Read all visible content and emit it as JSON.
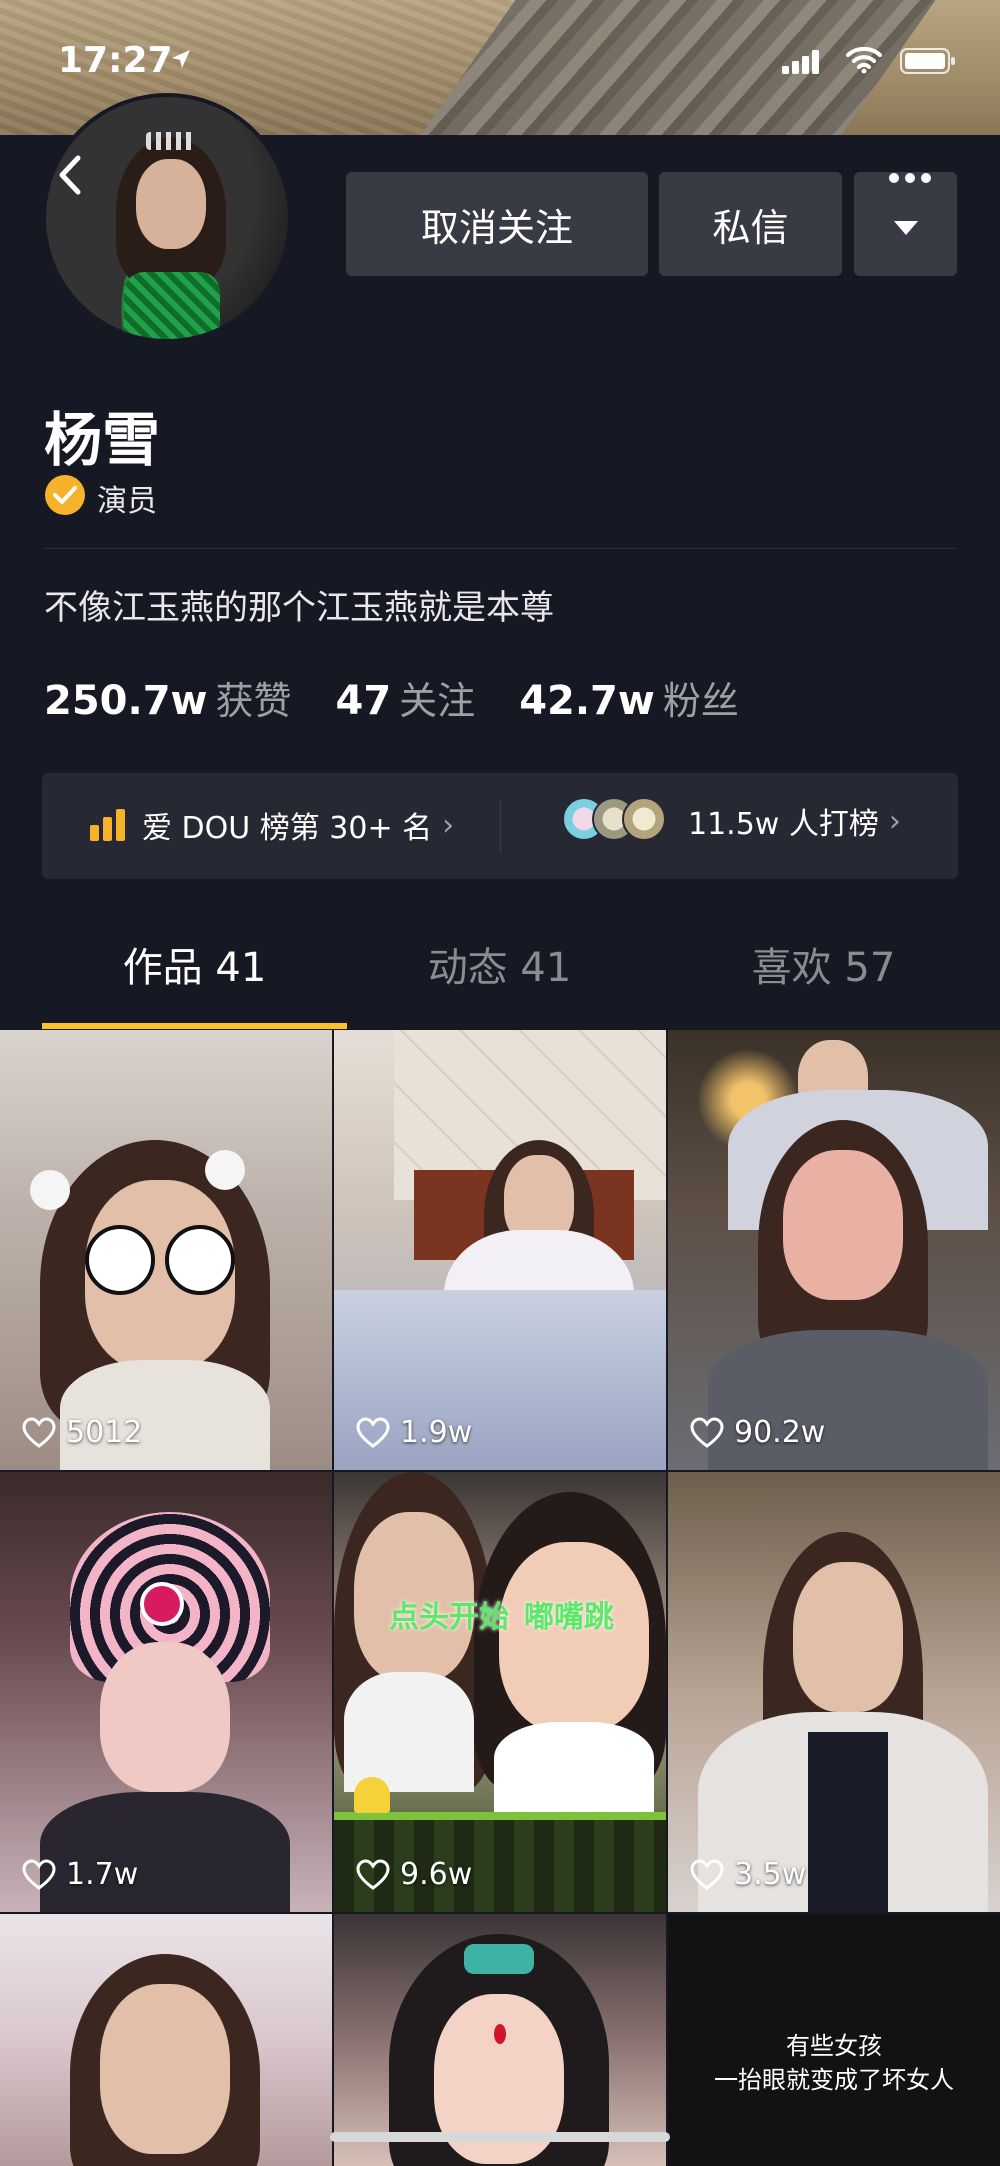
{
  "status_bar": {
    "time": "17:27"
  },
  "profile": {
    "name": "杨雪",
    "verified_label": "演员",
    "bio": "不像江玉燕的那个江玉燕就是本尊"
  },
  "actions": {
    "unfollow_label": "取消关注",
    "message_label": "私信"
  },
  "stats": [
    {
      "value": "250.7w",
      "label": "获赞"
    },
    {
      "value": "47",
      "label": "关注"
    },
    {
      "value": "42.7w",
      "label": "粉丝"
    }
  ],
  "ranking": {
    "rank_text": "爱 DOU 榜第 30+ 名",
    "supporters_text": "11.5w 人打榜"
  },
  "tabs": [
    {
      "label": "作品 41"
    },
    {
      "label": "动态 41"
    },
    {
      "label": "喜欢 57"
    }
  ],
  "videos": [
    {
      "likes": "5012"
    },
    {
      "likes": "1.9w"
    },
    {
      "likes": "90.2w"
    },
    {
      "likes": "1.7w"
    },
    {
      "likes": "9.6w",
      "overlay_left": "点头开始",
      "overlay_right": "嘟嘴跳"
    },
    {
      "likes": "3.5w"
    },
    {
      "likes": ""
    },
    {
      "likes": ""
    },
    {
      "likes": "",
      "caption_line1": "有些女孩",
      "caption_line2": "一抬眼就变成了坏女人"
    }
  ],
  "colors": {
    "background": "#161823",
    "button": "#393b44",
    "accent": "#f8c32b",
    "verified": "#f6b22a"
  }
}
